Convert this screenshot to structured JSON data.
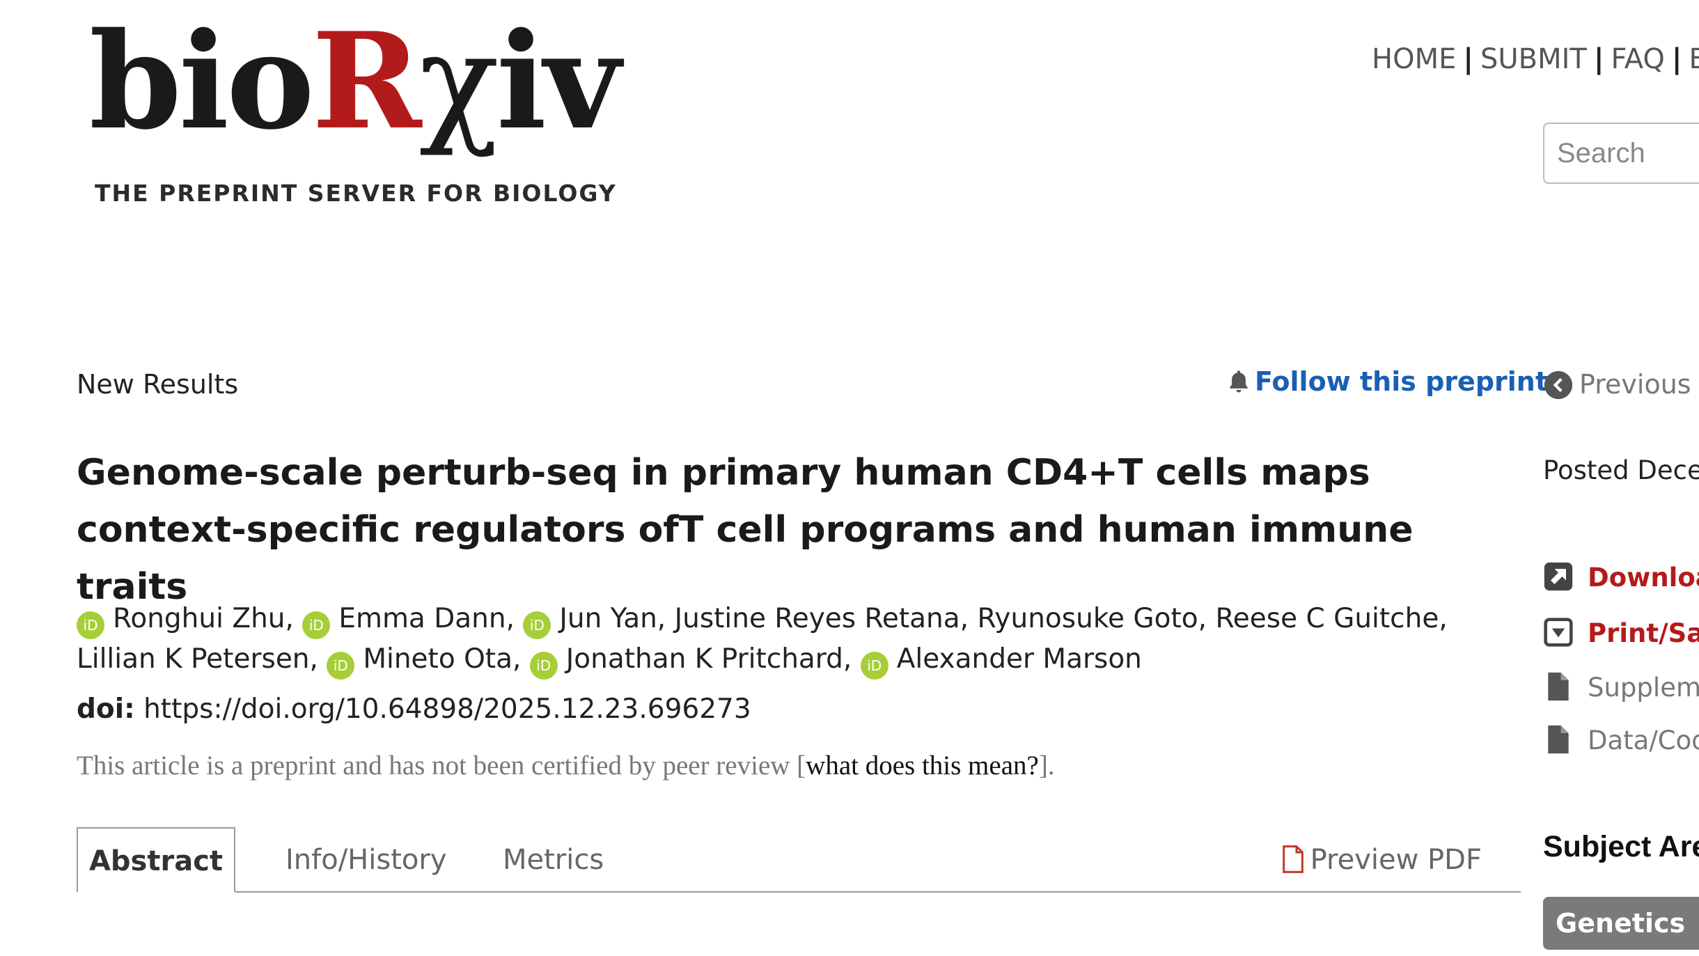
{
  "logo": {
    "word_a": "bio",
    "word_r": "R",
    "word_chi": "χ",
    "word_b": "iv",
    "tagline": "THE PREPRINT SERVER FOR BIOLOGY"
  },
  "nav": {
    "home": "HOME",
    "submit": "SUBMIT",
    "faq": "FAQ",
    "blog": "BL",
    "separator": "|"
  },
  "search": {
    "placeholder": "Search"
  },
  "article": {
    "label": "New Results",
    "follow": "Follow this preprint",
    "previous": "Previous",
    "title": "Genome-scale perturb-seq in primary human CD4+T cells maps context-specific regulators ofT cell programs and human immune traits",
    "authors": [
      "Ronghui Zhu,",
      "Emma Dann,",
      "Jun Yan, Justine Reyes Retana, Ryunosuke Goto, Reese C Guitche,",
      "Lillian K Petersen,",
      "Mineto Ota,",
      "Jonathan K Pritchard,",
      "Alexander Marson"
    ],
    "orcid_label": "iD",
    "doi_label": "doi:",
    "doi": "https://doi.org/10.64898/2025.12.23.696273",
    "preprint_note": "This article is a preprint and has not been certified by peer review [",
    "preprint_link": "what does this mean?",
    "preprint_note_end": "]."
  },
  "tabs": {
    "abstract": "Abstract",
    "info": "Info/History",
    "metrics": "Metrics",
    "pdf": "Preview PDF"
  },
  "sidebar": {
    "posted": "Posted Decem",
    "download": "Downloa",
    "print": "Print/Sav",
    "supplementary": "Suppleme",
    "data": "Data/Cod",
    "subject_heading": "Subject Are",
    "subject_badge": "Genetics"
  },
  "colors": {
    "brand_red": "#b31b1b",
    "link_blue": "#1a5fb4",
    "orcid_green": "#a6ce39",
    "badge_gray": "#7a7a7a"
  }
}
